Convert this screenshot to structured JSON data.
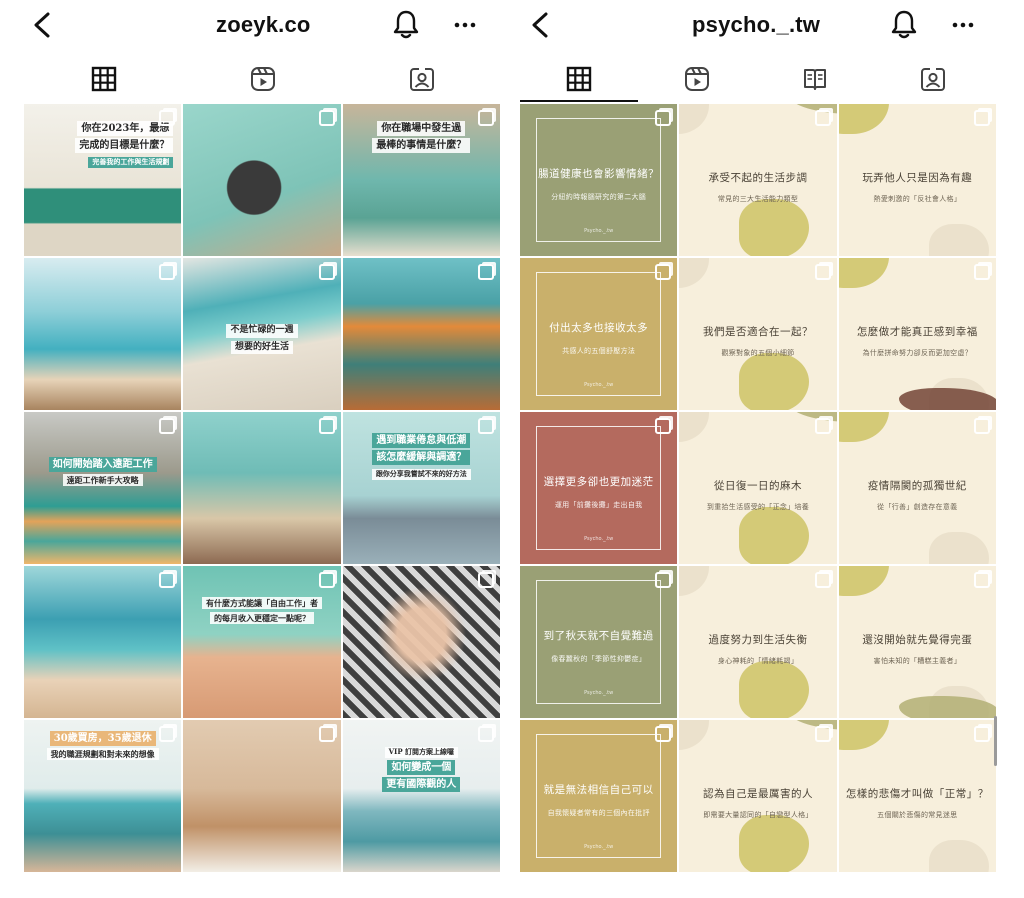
{
  "left": {
    "title": "zoeyk.co",
    "tabs": [
      "grid",
      "reels",
      "tagged"
    ],
    "posts": [
      {
        "caption": [
          "你在2023年，最想",
          "完成的目標是什麼？"
        ],
        "sub": "完善我的工作與生活規劃"
      },
      {
        "caption": [],
        "sub": ""
      },
      {
        "caption": [
          "你在職場中發生過",
          "最棒的事情是什麼？"
        ],
        "sub": ""
      },
      {
        "caption": [],
        "sub": ""
      },
      {
        "caption": [
          "不是忙碌的一週",
          "想要的好生活"
        ],
        "sub": ""
      },
      {
        "caption": [],
        "sub": ""
      },
      {
        "caption": [
          "如何開始踏入遠距工作"
        ],
        "sub": "遠距工作新手大攻略"
      },
      {
        "caption": [],
        "sub": ""
      },
      {
        "caption": [
          "遇到職業倦怠與低潮",
          "該怎麼緩解與調適？"
        ],
        "sub": "跟你分享我嘗試不來的好方法"
      },
      {
        "caption": [],
        "sub": ""
      },
      {
        "caption": [
          "有什麼方式能讓「自由工作」者",
          "的每月收入更穩定一點呢？"
        ],
        "sub": ""
      },
      {
        "caption": [],
        "sub": ""
      },
      {
        "caption": [
          "30歲買房，35歲退休"
        ],
        "sub": "我的職涯規劃和對未來的想像"
      },
      {
        "caption": [],
        "sub": ""
      },
      {
        "caption": [
          "如何變成一個",
          "更有國際觀的人"
        ],
        "sub": "VIP 訂閱方案上線囉"
      }
    ]
  },
  "right": {
    "title": "psycho._.tw",
    "tabs": [
      "grid",
      "reels",
      "guides",
      "tagged"
    ],
    "brand": "Psycho._.tw",
    "cards": [
      {
        "title": "腸道健康也會影響情緒？",
        "sub": "分紐約時報腦研究的第二大腦"
      },
      {
        "title": "承受不起的生活步調",
        "sub": "常見的三大生活能力類型"
      },
      {
        "title": "玩弄他人只是因為有趣",
        "sub": "熱愛刺激的「反社會人格」"
      },
      {
        "title": "付出太多也接收太多",
        "sub": "共感人的五個舒壓方法"
      },
      {
        "title": "我們是否適合在一起？",
        "sub": "觀察對象的五個小細節"
      },
      {
        "title": "怎麼做才能真正感到幸福",
        "sub": "為什麼拼命努力卻反而更加空虛？"
      },
      {
        "title": "選擇更多卻也更加迷茫",
        "sub": "運用「前攤後攤」走出自我"
      },
      {
        "title": "從日復一日的麻木",
        "sub": "到重拾生活感受的「正念」培養"
      },
      {
        "title": "疫情隔閡的孤獨世紀",
        "sub": "從「行善」創造存在意義"
      },
      {
        "title": "到了秋天就不自覺難過",
        "sub": "像春蠶秋的「季節性抑鬱症」"
      },
      {
        "title": "過度努力到生活失衡",
        "sub": "身心神耗的「情緒耗竭」"
      },
      {
        "title": "還沒開始就先覺得完蛋",
        "sub": "害怕未知的「糟糕主義者」"
      },
      {
        "title": "就是無法相信自己可以",
        "sub": "自我懷疑者常有的三個內在批評"
      },
      {
        "title": "認為自己是最厲害的人",
        "sub": "即需要大量認同的「自戀型人格」"
      },
      {
        "title": "怎樣的悲傷才叫做「正常」？",
        "sub": "五個關於悲傷的常見迷思"
      }
    ]
  },
  "colors": {
    "olive": "#9aa075",
    "mustard": "#c9b06b",
    "terracotta": "#b46a5e",
    "cream": "#f7efdc",
    "accent": "#4aa69a"
  }
}
